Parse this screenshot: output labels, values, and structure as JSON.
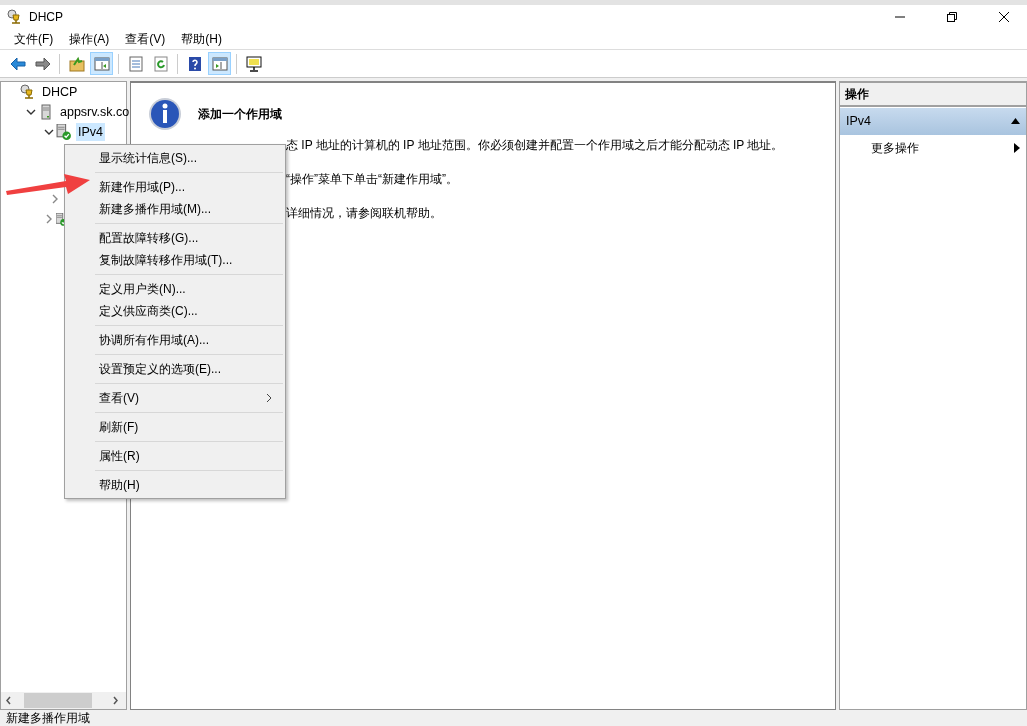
{
  "window": {
    "title": "DHCP"
  },
  "menu_bar": [
    {
      "label": "文件(F)"
    },
    {
      "label": "操作(A)"
    },
    {
      "label": "查看(V)"
    },
    {
      "label": "帮助(H)"
    }
  ],
  "toolbar": [
    {
      "pressed": false
    },
    {
      "pressed": false
    },
    {
      "pressed": false
    },
    {
      "pressed": true
    },
    {
      "pressed": false
    },
    {
      "pressed": false
    },
    {
      "pressed": false
    },
    {
      "pressed": true
    },
    {
      "pressed": false
    }
  ],
  "tree": [
    {
      "label": "DHCP",
      "kind": "root",
      "children": [
        {
          "label": "appsrv.sk.co",
          "kind": "server",
          "expanded": true,
          "children": [
            {
              "label": "IPv4",
              "kind": "protocol",
              "expanded": true,
              "selected": true,
              "children": [
                {
                  "expanded": false
                }
              ]
            },
            {
              "kind": "protocol",
              "expanded": false
            }
          ]
        }
      ]
    }
  ],
  "content": {
    "heading": "添加一个作用域",
    "paragraphs": [
      "态 IP 地址的计算机的 IP 地址范围。你必须创建并配置一个作用域之后才能分配动态 IP 地址。",
      "“操作”菜单下单击“新建作用域”。",
      "详细情况，请参阅联机帮助。"
    ]
  },
  "context_menu": [
    [
      {
        "label": "显示统计信息(S)..."
      }
    ],
    [
      {
        "label": "新建作用域(P)..."
      },
      {
        "label": "新建多播作用域(M)..."
      }
    ],
    [
      {
        "label": "配置故障转移(G)..."
      },
      {
        "label": "复制故障转移作用域(T)..."
      }
    ],
    [
      {
        "label": "定义用户类(N)..."
      },
      {
        "label": "定义供应商类(C)..."
      }
    ],
    [
      {
        "label": "协调所有作用域(A)..."
      }
    ],
    [
      {
        "label": "设置预定义的选项(E)..."
      }
    ],
    [
      {
        "label": "查看(V)",
        "submenu": true
      }
    ],
    [
      {
        "label": "刷新(F)"
      }
    ],
    [
      {
        "label": "属性(R)"
      }
    ],
    [
      {
        "label": "帮助(H)"
      }
    ]
  ],
  "actions_pane": {
    "title": "操作",
    "section": {
      "label": "IPv4",
      "expanded": true
    },
    "items": [
      {
        "label": "更多操作",
        "submenu": true
      }
    ]
  },
  "status_bar": "新建多播作用域"
}
